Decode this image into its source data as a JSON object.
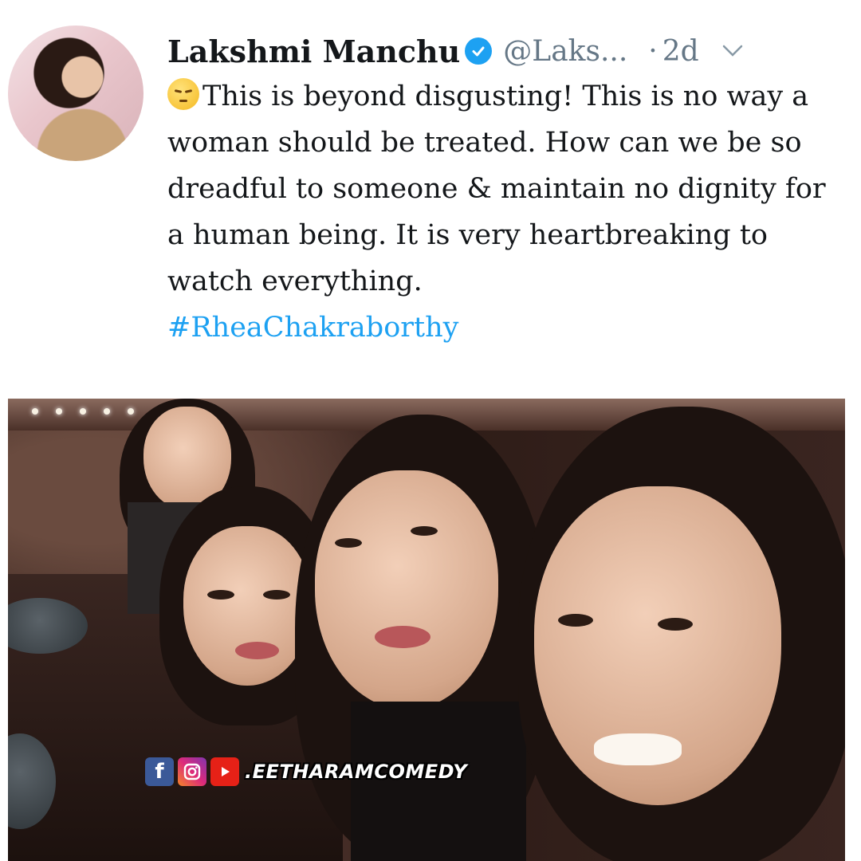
{
  "tweet": {
    "author_name": "Lakshmi Manchu",
    "handle": "@Laks...",
    "separator": "·",
    "time": "2d",
    "text": "This is beyond disgusting! This is no way a woman should be treated. How can we be so dreadful to someone & maintain no dignity for a human being. It is very heartbreaking to watch everything.",
    "hashtag": "#RheaChakraborthy",
    "emoji": "pensive-face-icon",
    "verified_color": "#1da1f2",
    "hashtag_color": "#1da1f2"
  },
  "watermark": {
    "text": ".EETHARAMCOMEDY",
    "icons": [
      "facebook-icon",
      "instagram-icon",
      "youtube-icon"
    ]
  }
}
